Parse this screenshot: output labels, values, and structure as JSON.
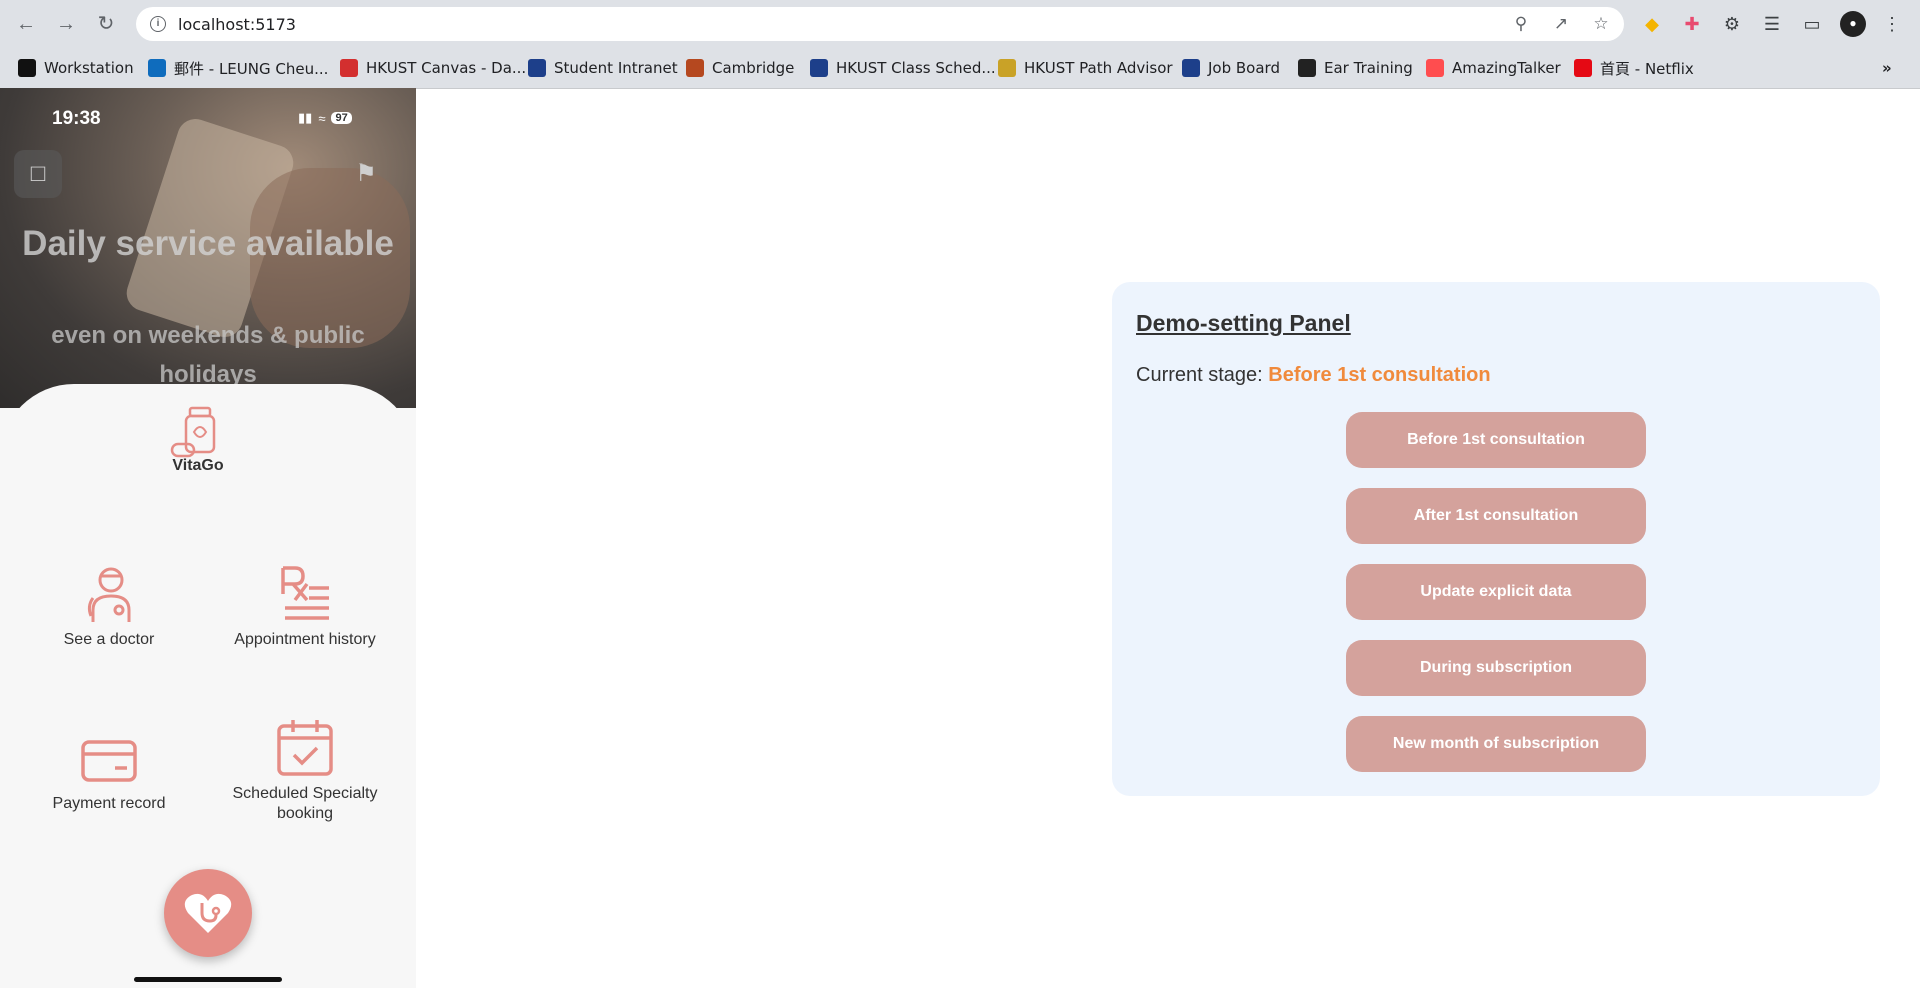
{
  "browser": {
    "url": "localhost:5173",
    "bookmarks": [
      {
        "label": "Workstation",
        "icon": "notion-icon",
        "color": "#111111"
      },
      {
        "label": "郵件 - LEUNG Cheu...",
        "icon": "outlook-icon",
        "color": "#0f6cbd"
      },
      {
        "label": "HKUST Canvas - Da...",
        "icon": "canvas-icon",
        "color": "#d32f2f"
      },
      {
        "label": "Student Intranet",
        "icon": "hkust-icon",
        "color": "#1d3f8a"
      },
      {
        "label": "Cambridge",
        "icon": "cambridge-icon",
        "color": "#b5481f"
      },
      {
        "label": "HKUST Class Sched...",
        "icon": "ust-class-icon",
        "color": "#1d3f8a"
      },
      {
        "label": "HKUST Path Advisor",
        "icon": "path-advisor-icon",
        "color": "#c9a227"
      },
      {
        "label": "Job Board",
        "icon": "hkust-icon",
        "color": "#1d3f8a"
      },
      {
        "label": "Ear Training",
        "icon": "ear-training-icon",
        "color": "#222222"
      },
      {
        "label": "AmazingTalker",
        "icon": "amazingtalker-icon",
        "color": "#ff4d4f"
      },
      {
        "label": "首頁 - Netflix",
        "icon": "netflix-icon",
        "color": "#e50914"
      }
    ]
  },
  "phone": {
    "status": {
      "time": "19:38",
      "battery": "97"
    },
    "hero": {
      "title": "Daily service available",
      "subtitle": "even on weekends & public holidays"
    },
    "app_name": "VitaGo",
    "tiles": [
      {
        "label": "See a doctor",
        "icon": "doctor-icon"
      },
      {
        "label": "Appointment history",
        "icon": "prescription-icon"
      },
      {
        "label": "Payment record",
        "icon": "credit-card-icon"
      },
      {
        "label": "Scheduled Specialty booking",
        "icon": "calendar-check-icon"
      }
    ],
    "accent": "#e58d86"
  },
  "panel": {
    "title": "Demo-setting Panel",
    "stage_label": "Current stage:",
    "stage_value": "Before 1st consultation",
    "buttons": [
      "Before 1st consultation",
      "After 1st consultation",
      "Update explicit data",
      "During subscription",
      "New month of subscription"
    ],
    "button_color": "#d4a29c",
    "stage_color": "#f08a3c"
  }
}
